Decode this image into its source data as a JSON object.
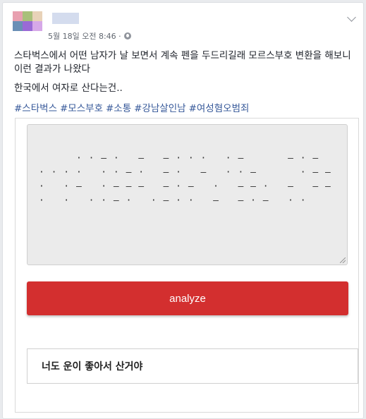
{
  "post": {
    "timestamp": "5월 18일 오전 8:46 ·",
    "text_line1": "스타벅스에서 어떤 남자가 날 보면서 계속 펜을 두드리길래 모르스부호 변환을 해보니 이런 결과가 나왔다",
    "text_line2": "한국에서 여자로 산다는건..",
    "hashtags": [
      "#스타벅스",
      "#모스부호",
      "#소통",
      "#강남살인남",
      "#여성혐오범죄"
    ]
  },
  "avatar_colors": [
    "#e8a0b0",
    "#a8c07a",
    "#e8d2b8",
    "#6a8fb6",
    "#9a6ad6",
    "#d6a8e8",
    "#ffffff",
    "#ffffff",
    "#ffffff"
  ],
  "icons": {
    "privacy": "globe-icon",
    "menu": "chevron-down-icon"
  },
  "translator": {
    "morse_text": "· · – ·   –   – · · ·   · –       – · –   · · · ·   · · – ·   – ·   –   · · –       · – – ·   · –   · – – –   – · –   ·   – – ·   –   – – ·   ·   · · – ·   · – · ·   –   – · –   · ·",
    "analyze_label": "analyze",
    "result_text": "너도 운이 좋아서 산거야"
  },
  "colors": {
    "hashtag": "#365899",
    "button": "#d32f2f",
    "textarea_bg": "#ebebeb"
  }
}
